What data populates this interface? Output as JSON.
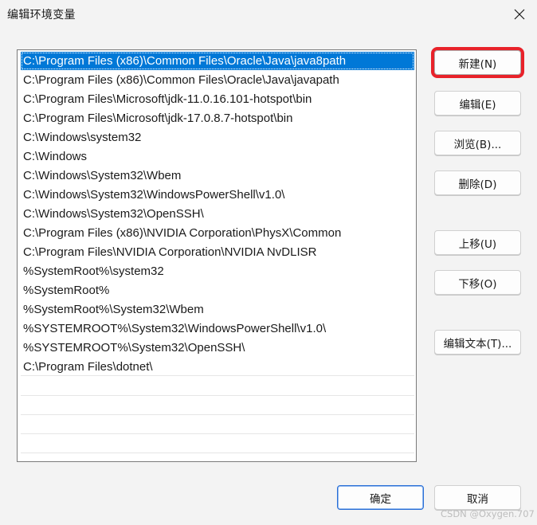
{
  "window": {
    "title": "编辑环境变量"
  },
  "list": {
    "items": [
      "C:\\Program Files (x86)\\Common Files\\Oracle\\Java\\java8path",
      "C:\\Program Files (x86)\\Common Files\\Oracle\\Java\\javapath",
      "C:\\Program Files\\Microsoft\\jdk-11.0.16.101-hotspot\\bin",
      "C:\\Program Files\\Microsoft\\jdk-17.0.8.7-hotspot\\bin",
      "C:\\Windows\\system32",
      "C:\\Windows",
      "C:\\Windows\\System32\\Wbem",
      "C:\\Windows\\System32\\WindowsPowerShell\\v1.0\\",
      "C:\\Windows\\System32\\OpenSSH\\",
      "C:\\Program Files (x86)\\NVIDIA Corporation\\PhysX\\Common",
      "C:\\Program Files\\NVIDIA Corporation\\NVIDIA NvDLISR",
      "%SystemRoot%\\system32",
      "%SystemRoot%",
      "%SystemRoot%\\System32\\Wbem",
      "%SYSTEMROOT%\\System32\\WindowsPowerShell\\v1.0\\",
      "%SYSTEMROOT%\\System32\\OpenSSH\\",
      "C:\\Program Files\\dotnet\\"
    ],
    "selected_index": 0
  },
  "buttons": {
    "new": "新建(N)",
    "edit": "编辑(E)",
    "browse": "浏览(B)...",
    "delete": "删除(D)",
    "move_up": "上移(U)",
    "move_down": "下移(O)",
    "edit_text": "编辑文本(T)...",
    "ok": "确定",
    "cancel": "取消"
  },
  "watermark": "CSDN @Oxygen.707",
  "colors": {
    "selection": "#0078d7",
    "highlight_box": "#e8222a"
  }
}
